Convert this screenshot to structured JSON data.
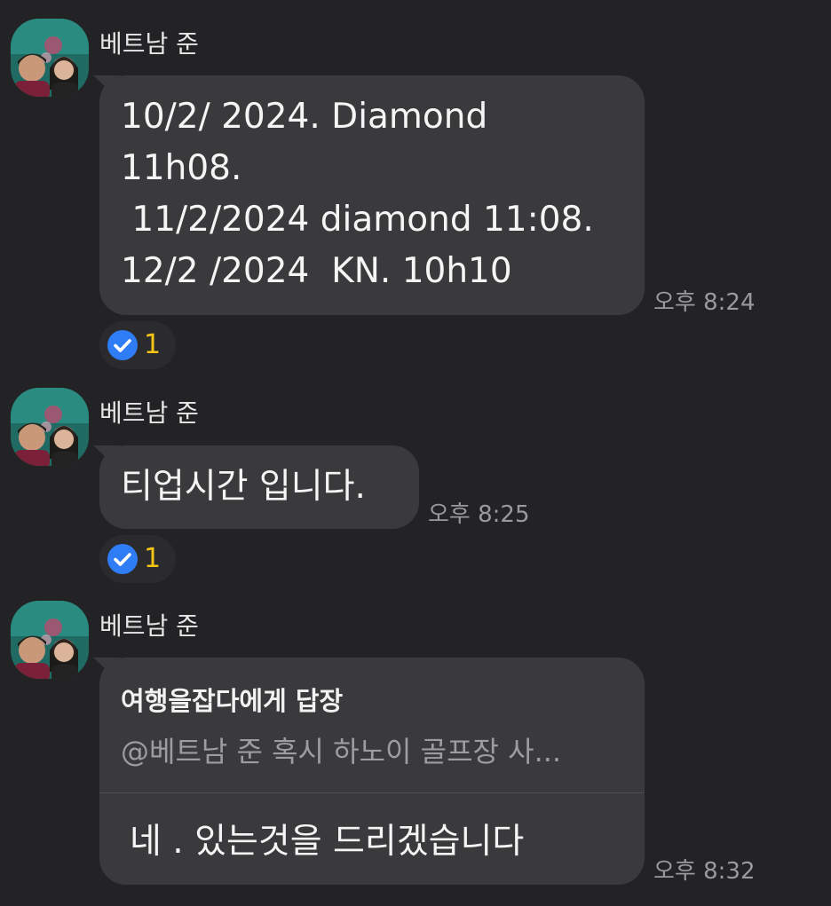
{
  "messages": [
    {
      "sender": "베트남 준",
      "lines": [
        "10/2/ 2024. Diamond",
        "11h08.",
        " 11/2/2024 diamond 11:08.",
        "12/2 /2024  KN. 10h10"
      ],
      "time": "오후 8:24",
      "reaction": {
        "icon": "check-badge-icon",
        "count": "1"
      }
    },
    {
      "sender": "베트남 준",
      "lines": [
        "티업시간 입니다."
      ],
      "time": "오후 8:25",
      "reaction": {
        "icon": "check-badge-icon",
        "count": "1"
      }
    },
    {
      "sender": "베트남 준",
      "reply": {
        "header": "여행을잡다에게 답장",
        "preview": "@베트남 준 혹시 하노이 골프장 사..."
      },
      "body": "네 . 있는것을 드리겠습니다",
      "time": "오후 8:32"
    }
  ],
  "colors": {
    "background": "#232325",
    "bubble": "#3a3a3c",
    "reaction_count": "#f5c518",
    "check_badge": "#2f7df6"
  }
}
